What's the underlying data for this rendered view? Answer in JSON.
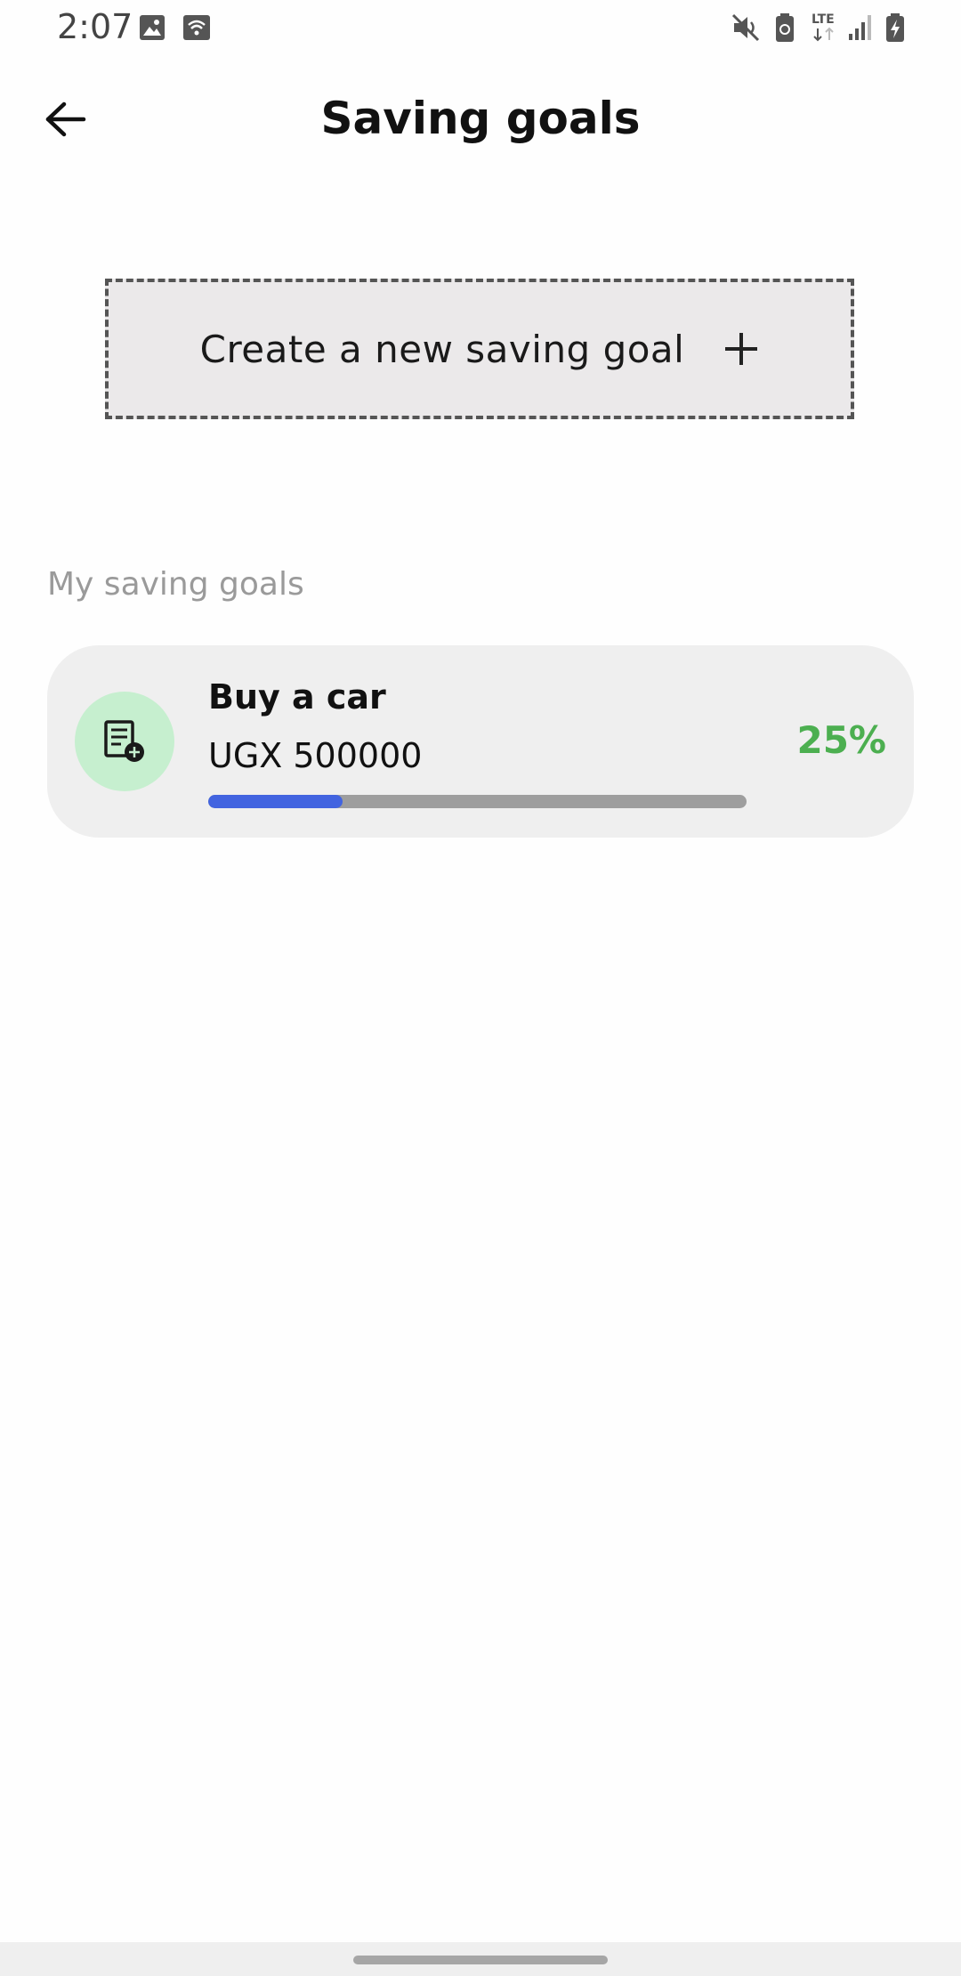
{
  "status_bar": {
    "time": "2:07",
    "icons": [
      "image-icon",
      "wifi-icon",
      "mute-icon",
      "battery-saver-icon",
      "lte-icon",
      "signal-icon",
      "battery-charging-icon"
    ],
    "lte_label": "LTE"
  },
  "header": {
    "title": "Saving goals",
    "back_icon": "arrow-left-icon"
  },
  "create_goal": {
    "label": "Create a new saving goal",
    "icon": "plus-icon"
  },
  "section": {
    "label": "My saving goals"
  },
  "goals": [
    {
      "name": "Buy a car",
      "amount": "UGX 500000",
      "percent_label": "25%",
      "progress": 0.25,
      "icon": "document-add-icon",
      "colors": {
        "progress_fill": "#4264e0",
        "progress_track": "#9e9e9e",
        "percent_text": "#4caf50",
        "avatar_bg": "#c6efcf"
      }
    }
  ]
}
